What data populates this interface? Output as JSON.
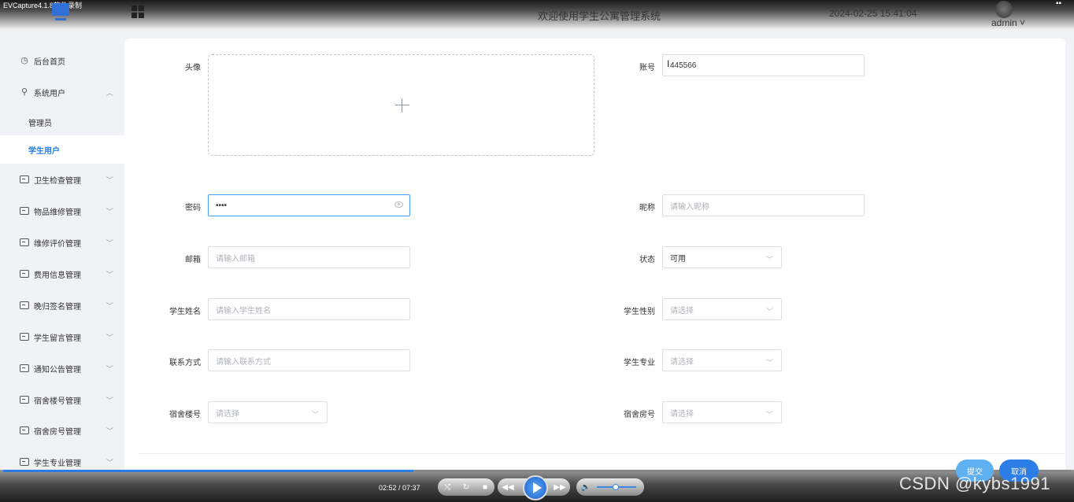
{
  "recorder": {
    "label": "EVCapture4.1.8软件录制",
    "time": "02:52 / 07:37",
    "watermark": "CSDN @kybs1991",
    "progress": 0.384
  },
  "header": {
    "title": "欢迎使用学生公寓管理系统",
    "datetime": "2024-02-25 15:41:04",
    "user": "admin ˅"
  },
  "sidebar": {
    "home": "后台首页",
    "system_user": "系统用户",
    "sub_items": [
      "管理员",
      "学生用户"
    ],
    "items": [
      "卫生检查管理",
      "物品维修管理",
      "维修评价管理",
      "费用信息管理",
      "晚归签名管理",
      "学生留言管理",
      "通知公告管理",
      "宿舍楼号管理",
      "宿舍房号管理",
      "学生专业管理"
    ]
  },
  "form": {
    "avatar_label": "头像",
    "account_label": "账号",
    "account_value": "445566",
    "password_label": "密码",
    "password_value": "••••",
    "nickname_label": "昵称",
    "nickname_placeholder": "请输入昵称",
    "email_label": "邮箱",
    "email_placeholder": "请输入邮箱",
    "status_label": "状态",
    "status_value": "可用",
    "name_label": "学生姓名",
    "name_placeholder": "请输入学生姓名",
    "gender_label": "学生性别",
    "gender_placeholder": "请选择",
    "phone_label": "联系方式",
    "phone_placeholder": "请输入联系方式",
    "major_label": "学生专业",
    "major_placeholder": "请选择",
    "building_label": "宿舍楼号",
    "building_placeholder": "请选择",
    "room_label": "宿舍房号",
    "room_placeholder": "请选择"
  },
  "buttons": {
    "submit": "提交",
    "cancel": "取消"
  },
  "colors": {
    "accent": "#1f78e0",
    "submit": "#5fb0f0",
    "cancel": "#2c7de6"
  }
}
